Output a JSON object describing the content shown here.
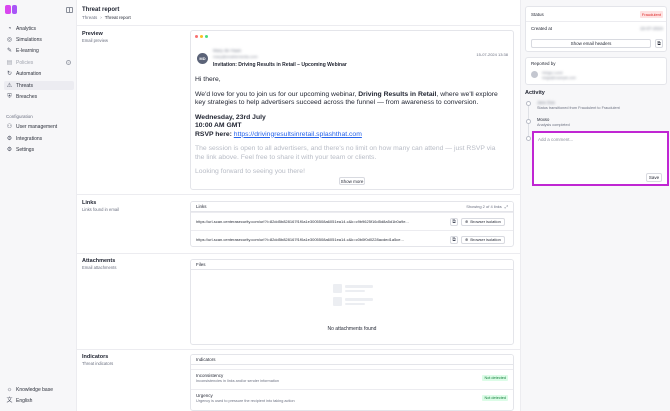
{
  "sidebar": {
    "items": [
      {
        "label": "Analytics",
        "icon": "analytics-icon"
      },
      {
        "label": "Simulations",
        "icon": "simulations-icon"
      },
      {
        "label": "E-learning",
        "icon": "elearning-icon"
      },
      {
        "label": "Policies",
        "icon": "policies-icon"
      },
      {
        "label": "Automation",
        "icon": "automation-icon"
      },
      {
        "label": "Threats",
        "icon": "threats-icon"
      },
      {
        "label": "Breaches",
        "icon": "breaches-icon"
      }
    ],
    "config_label": "Configuration",
    "config_items": [
      {
        "label": "User management",
        "icon": "user-icon"
      },
      {
        "label": "Integrations",
        "icon": "integrations-icon"
      },
      {
        "label": "Settings",
        "icon": "gear-icon"
      }
    ],
    "bottom_items": [
      {
        "label": "Knowledge base",
        "icon": "lightbulb-icon"
      },
      {
        "label": "English",
        "icon": "translate-icon"
      }
    ]
  },
  "header": {
    "title": "Threat report",
    "breadcrumb": [
      "Threats",
      "Threat report"
    ]
  },
  "preview": {
    "title": "Preview",
    "subtitle": "Email preview",
    "avatar_initials": "MD",
    "sender_name": "Mary de Haan",
    "sender_email": "mary@enablemedia.com",
    "date": "15-07-2024 13:38",
    "subject": "Invitation: Driving Results in Retail – Upcoming Webinar",
    "greeting": "Hi there,",
    "body_intro": "We'd love for you to join us for our upcoming webinar, ",
    "body_bold": "Driving Results in Retail",
    "body_rest": ", where we'll explore key strategies to help advertisers succeed across the funnel — from awareness to conversion.",
    "event_date": "Wednesday, 23rd July",
    "event_time": "10:00 AM GMT",
    "rsvp_label": "RSVP here: ",
    "rsvp_link": "https://drivingresultsinretail.splashthat.com",
    "body_2": "The session is open to all advertisers, and there's no limit on how many can attend — just RSVP via the link above. Feel free to share it with your team or clients.",
    "body_3": "Looking forward to seeing you there!",
    "show_more": "Show more"
  },
  "links": {
    "title": "Links",
    "subtitle": "Links found in email",
    "card_title": "Links",
    "count": "Showing 2 of 4 links",
    "items": [
      {
        "url": "https://url-scan.centerasecurity.com/url?l=82dd5b828167f1f0a1e3005508a6051ea14.c&k=c9b9625f16d5d8a5d1b0a9e..."
      },
      {
        "url": "https://url-scan.centerasecurity.com/url?l=82dd5b828167f1f0a1e3005508a6051ea14.c&k=c0b0f0d0228acded1a5ce..."
      }
    ],
    "isolation_label": "Browser isolation"
  },
  "attachments": {
    "title": "Attachments",
    "subtitle": "Email attachments",
    "card_title": "Files",
    "empty": "No attachments found"
  },
  "indicators": {
    "title": "Indicators",
    "subtitle": "Threat indicators",
    "card_title": "Indicators",
    "items": [
      {
        "title": "Inconsistency",
        "desc": "Inconsistencies in links and/or sender information",
        "badge": "Not detected"
      },
      {
        "title": "Urgency",
        "desc": "Urgency is used to pressure the recipient into taking action",
        "badge": "Not detected"
      }
    ]
  },
  "right": {
    "status_label": "Status",
    "status_value": "Fraudulent",
    "created_label": "Created at",
    "created_value": "15-07-2024",
    "show_headers": "Show email headers",
    "reported_by": "Reported by",
    "reporter_name": "Helga Lund",
    "reporter_email": "helga@example.com",
    "activity_title": "Activity",
    "activity": [
      {
        "name": "Jane Doe",
        "text": "Status transitioned from Fraudulent to Fraudulent"
      },
      {
        "name": "Moxso",
        "text": "Analysis completed"
      }
    ],
    "comment_placeholder": "Add a comment...",
    "save": "Save"
  },
  "colors": {
    "accent": "#c026d3",
    "danger": "#dc2626",
    "success": "#15803d"
  }
}
